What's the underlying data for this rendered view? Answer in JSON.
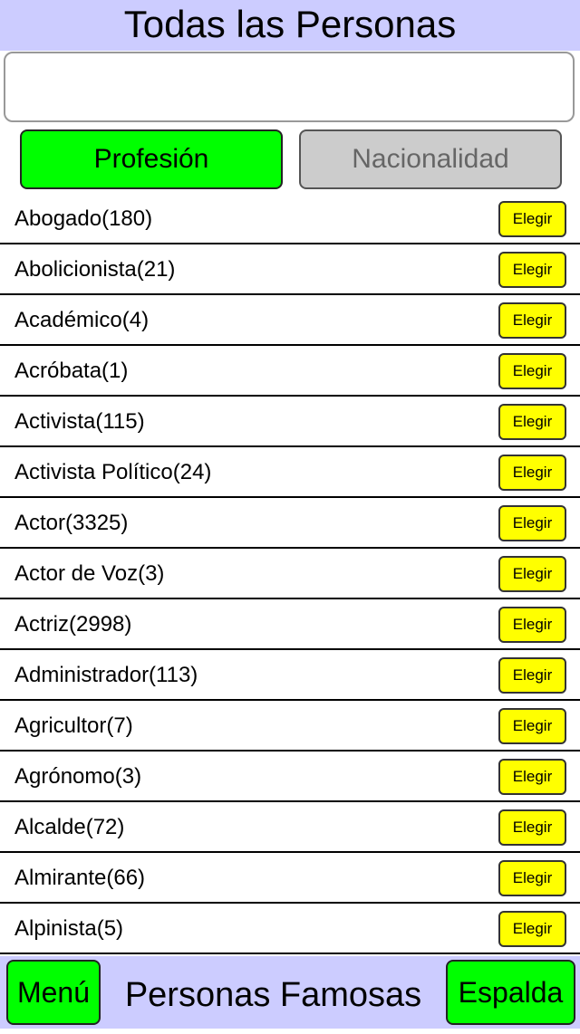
{
  "header": {
    "title": "Todas las Personas"
  },
  "search": {
    "value": "",
    "placeholder": ""
  },
  "segments": {
    "profession": "Profesión",
    "nationality": "Nacionalidad"
  },
  "list": {
    "pick_label": "Elegir",
    "items": [
      "Abogado(180)",
      "Abolicionista(21)",
      "Académico(4)",
      "Acróbata(1)",
      "Activista(115)",
      "Activista Político(24)",
      "Actor(3325)",
      "Actor de Voz(3)",
      "Actriz(2998)",
      "Administrador(113)",
      "Agricultor(7)",
      "Agrónomo(3)",
      "Alcalde(72)",
      "Almirante(66)",
      "Alpinista(5)"
    ]
  },
  "footer": {
    "menu_label": "Menú",
    "title": "Personas Famosas",
    "back_label": "Espalda"
  },
  "colors": {
    "header_bg": "#ccccff",
    "active_green": "#00ff00",
    "inactive_gray": "#cccccc",
    "pick_yellow": "#ffff00"
  }
}
